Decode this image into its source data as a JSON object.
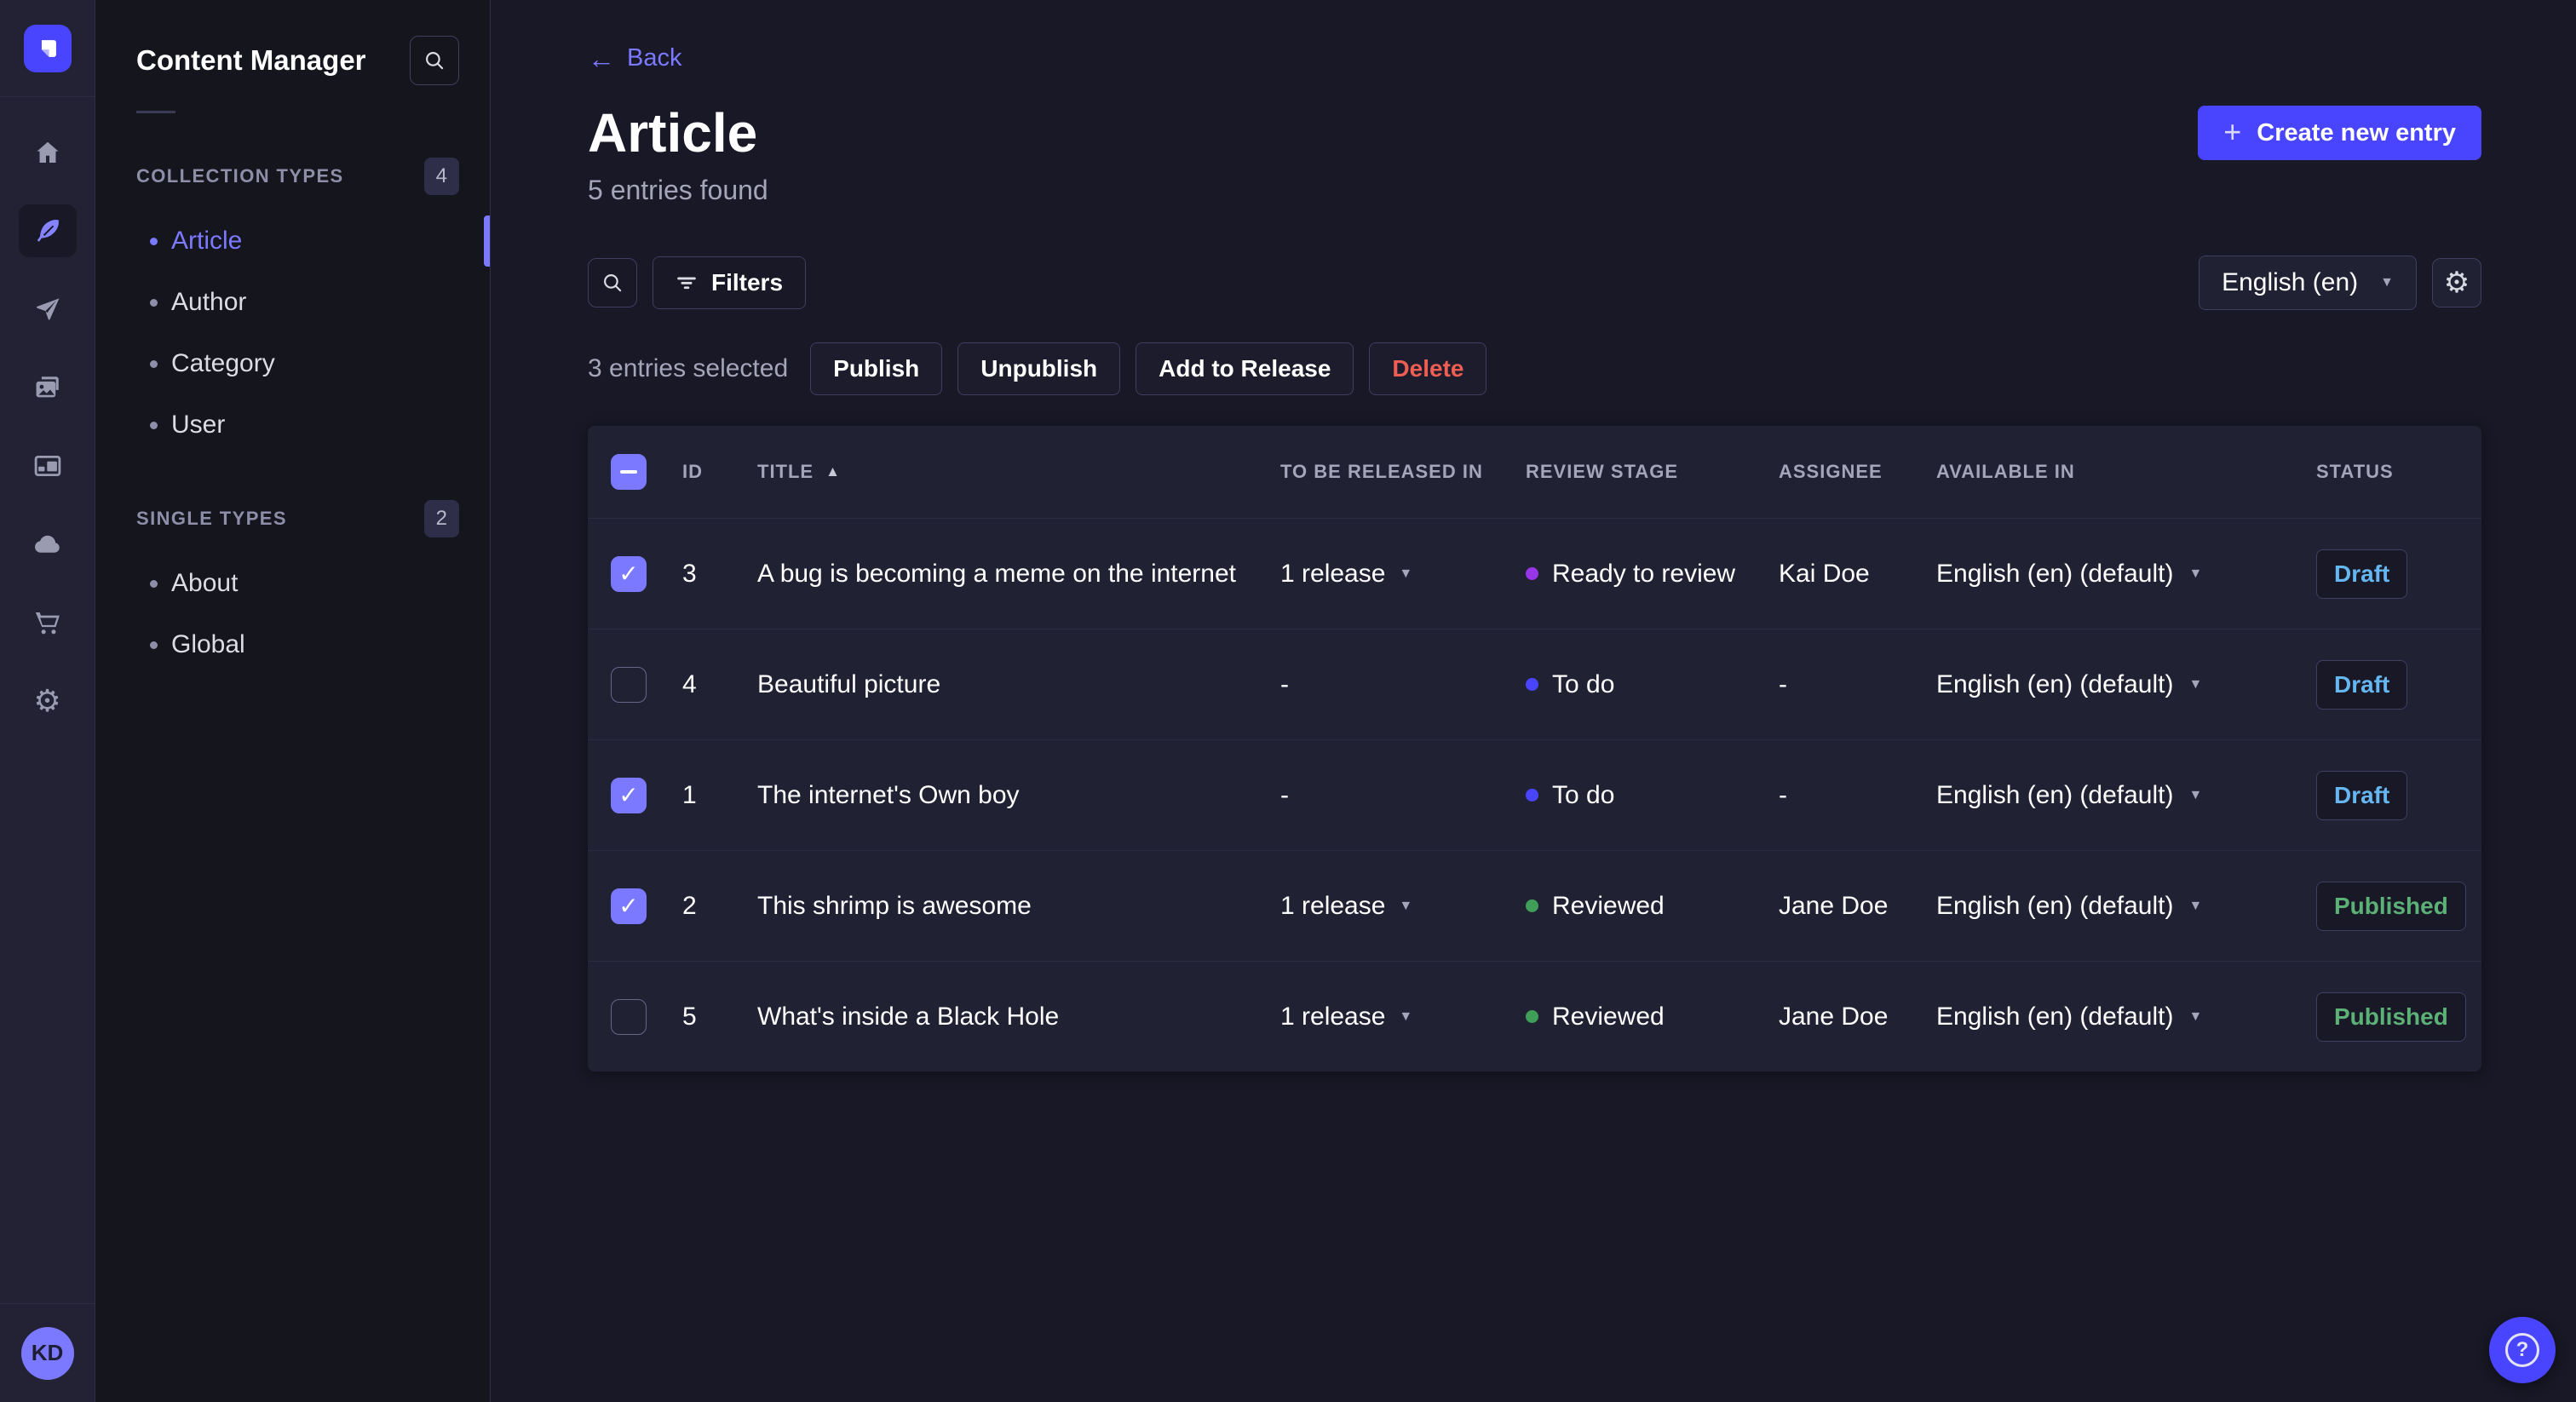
{
  "navbar": {
    "icons": [
      {
        "name": "home-icon",
        "active": false
      },
      {
        "name": "content-manager-feather-icon",
        "active": true
      },
      {
        "name": "releases-paper-plane-icon",
        "active": false
      },
      {
        "name": "media-library-images-icon",
        "active": false
      },
      {
        "name": "content-type-builder-layout-icon",
        "active": false
      },
      {
        "name": "deploy-cloud-icon",
        "active": false
      },
      {
        "name": "marketplace-cart-icon",
        "active": false
      },
      {
        "name": "settings-gear-icon",
        "active": false
      }
    ],
    "avatar_initials": "KD"
  },
  "sidebar": {
    "title": "Content Manager",
    "sections": [
      {
        "label": "COLLECTION TYPES",
        "count": "4",
        "items": [
          {
            "label": "Article",
            "active": true
          },
          {
            "label": "Author",
            "active": false
          },
          {
            "label": "Category",
            "active": false
          },
          {
            "label": "User",
            "active": false
          }
        ]
      },
      {
        "label": "SINGLE TYPES",
        "count": "2",
        "items": [
          {
            "label": "About",
            "active": false
          },
          {
            "label": "Global",
            "active": false
          }
        ]
      }
    ]
  },
  "header": {
    "back_label": "Back",
    "title": "Article",
    "subtitle": "5 entries found",
    "create_button_label": "Create new entry"
  },
  "toolbar": {
    "filters_label": "Filters",
    "locale_value": "English (en)"
  },
  "selection": {
    "text": "3 entries selected",
    "actions": [
      "Publish",
      "Unpublish",
      "Add to Release",
      "Delete"
    ]
  },
  "table": {
    "headers": {
      "id": "ID",
      "title": "TITLE",
      "released": "TO BE RELEASED IN",
      "review": "REVIEW STAGE",
      "assignee": "ASSIGNEE",
      "available": "AVAILABLE IN",
      "status": "STATUS"
    },
    "sort": {
      "column": "TITLE",
      "direction": "asc"
    },
    "rows": [
      {
        "selected": true,
        "id": "3",
        "title": "A bug is becoming a meme on the internet",
        "released": "1 release",
        "stage": "Ready to review",
        "stage_color": "#9736e8",
        "assignee": "Kai Doe",
        "available": "English (en) (default)",
        "status": "Draft"
      },
      {
        "selected": false,
        "id": "4",
        "title": "Beautiful picture",
        "released": "-",
        "stage": "To do",
        "stage_color": "#4945ff",
        "assignee": "-",
        "available": "English (en) (default)",
        "status": "Draft"
      },
      {
        "selected": true,
        "id": "1",
        "title": "The internet's Own boy",
        "released": "-",
        "stage": "To do",
        "stage_color": "#4945ff",
        "assignee": "-",
        "available": "English (en) (default)",
        "status": "Draft"
      },
      {
        "selected": true,
        "id": "2",
        "title": "This shrimp is awesome",
        "released": "1 release",
        "stage": "Reviewed",
        "stage_color": "#3f9e58",
        "assignee": "Jane Doe",
        "available": "English (en) (default)",
        "status": "Published"
      },
      {
        "selected": false,
        "id": "5",
        "title": "What's inside a Black Hole",
        "released": "1 release",
        "stage": "Reviewed",
        "stage_color": "#3f9e58",
        "assignee": "Jane Doe",
        "available": "English (en) (default)",
        "status": "Published"
      }
    ]
  },
  "colors": {
    "accent": "#4945ff",
    "accent_light": "#7b79ff",
    "danger": "#ee5e52",
    "status_draft": "#66b7f1",
    "status_published": "#5cb176",
    "page_bg": "#181826",
    "surface_bg": "#212134"
  }
}
